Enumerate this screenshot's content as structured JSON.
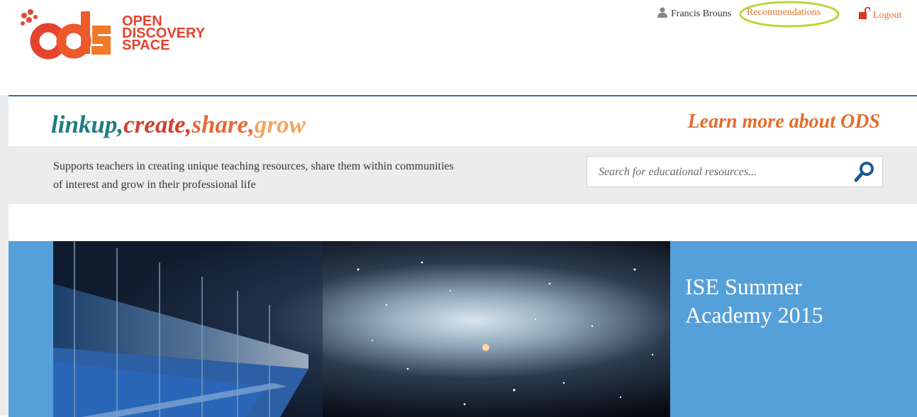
{
  "header": {
    "logo_lines": [
      "OPEN",
      "DISCOVERY",
      "SPACE"
    ],
    "logo_mark": "ODS",
    "user_name": "Francis Brouns",
    "recommendations_label": "Recommendations",
    "logout_label": "Logout"
  },
  "banner": {
    "tagline": {
      "linkup": "linkup,",
      "create": "create,",
      "share": "share,",
      "grow": "grow"
    },
    "learn_more": "Learn more about ODS",
    "description": "Supports teachers in creating unique teaching resources, share them within communities of interest and grow in their professional life",
    "search_placeholder": "Search for educational resources..."
  },
  "hero": {
    "title": "ISE Summer Academy 2015"
  },
  "colors": {
    "accent_orange": "#e36d2b",
    "frame_blue": "#2f6da0",
    "hero_blue": "#56a0d9",
    "highlight_ring": "#b9d63a"
  },
  "icons": [
    "user-icon",
    "lock-icon",
    "search-icon"
  ]
}
